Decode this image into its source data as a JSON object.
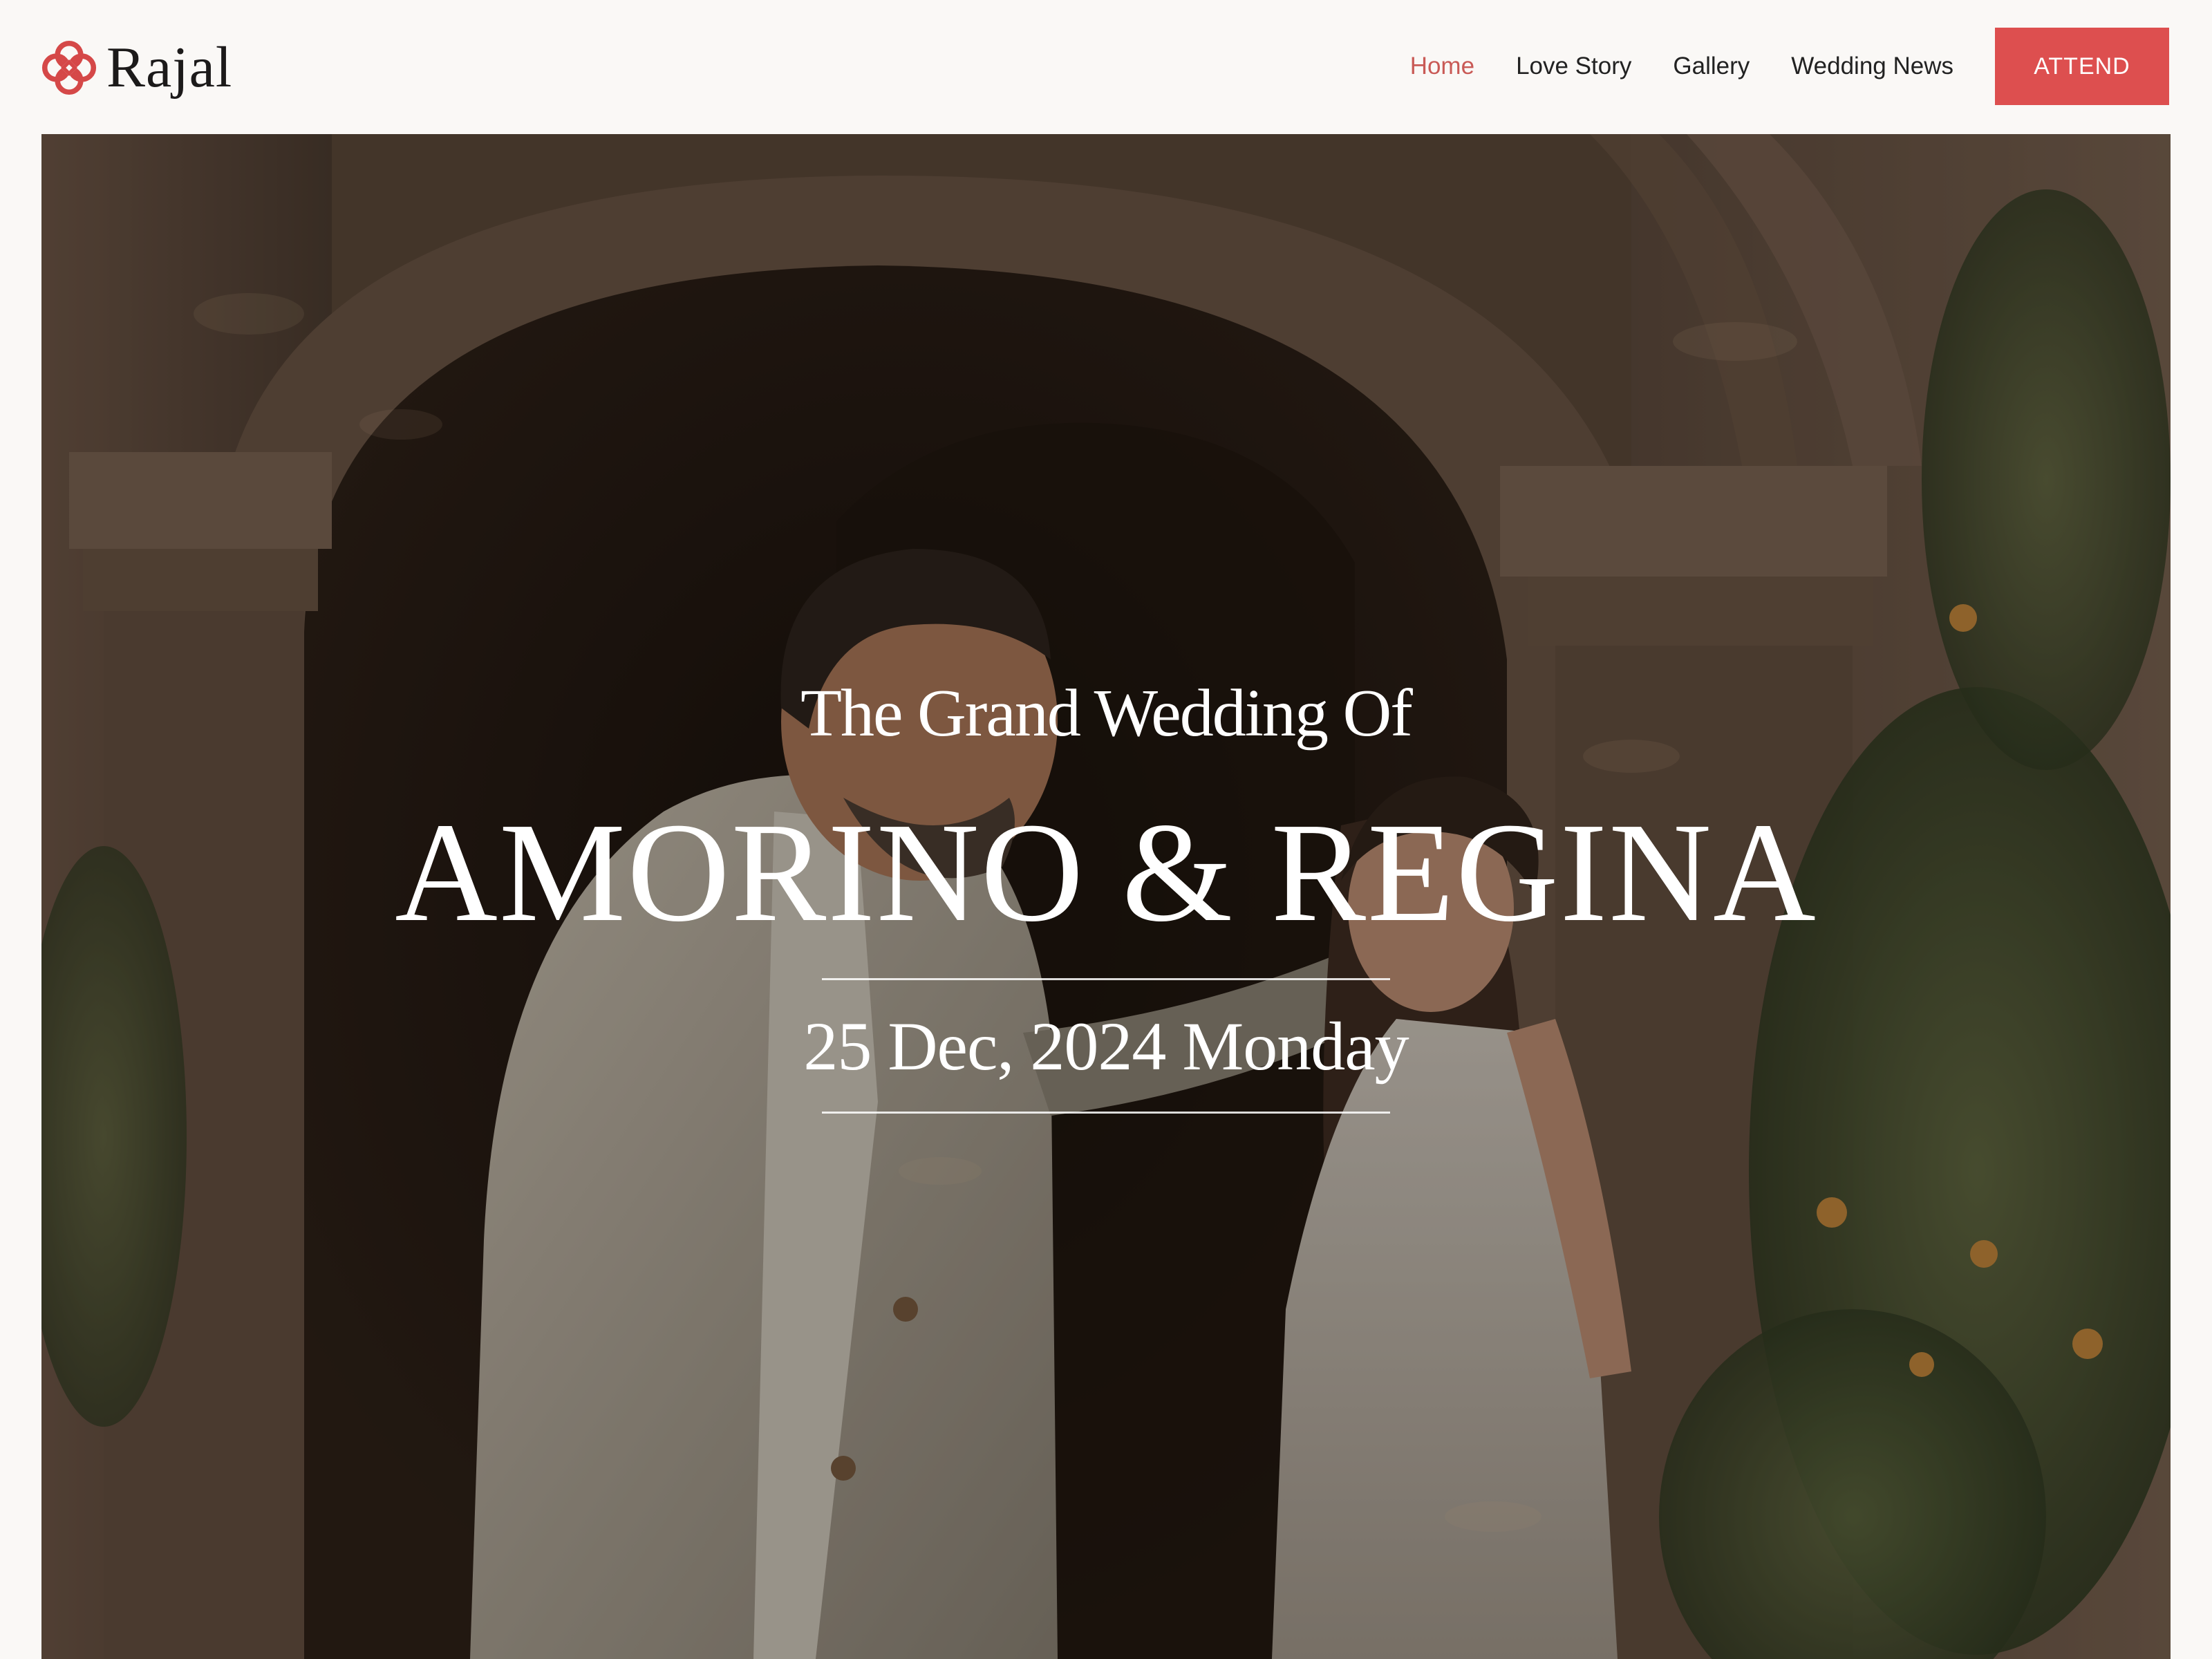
{
  "brand": {
    "name": "Rajal",
    "accent_color": "#dd4f4f",
    "logo_icon": "quatrefoil-logo-icon"
  },
  "nav": {
    "items": [
      {
        "label": "Home",
        "active": true
      },
      {
        "label": "Love Story",
        "active": false
      },
      {
        "label": "Gallery",
        "active": false
      },
      {
        "label": "Wedding News",
        "active": false
      }
    ],
    "cta_label": "ATTEND"
  },
  "hero": {
    "kicker": "The Grand Wedding Of",
    "names": "AMORINO & REGINA",
    "date": "25 Dec, 2024 Monday",
    "image": "couple-under-stone-archway-photo"
  }
}
